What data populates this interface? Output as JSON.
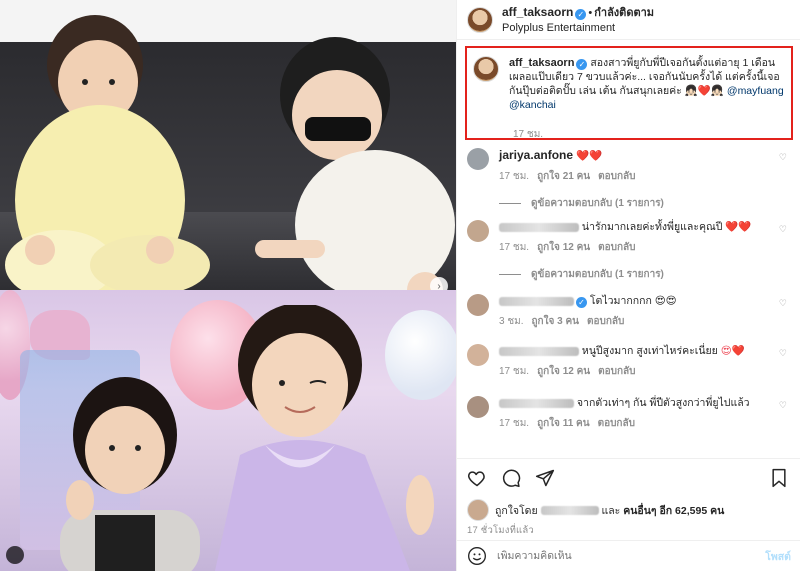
{
  "header": {
    "username": "aff_taksaorn",
    "follow_state": "กำลังติดตาม",
    "subtitle": "Polyplus Entertainment"
  },
  "caption": {
    "username": "aff_taksaorn",
    "text": "สองสาวพี่ยูกับพี่ปีเจอกันตั้งแต่อายุ 1 เดือน เผลอแป๊บเดียว 7 ขวบแล้วค่ะ... เจอกันนับครั้งได้ แต่ครั้งนี้เจอกันปุ๊บต่อติดปั๊บ เล่น เต้น กันสนุกเลยค่ะ",
    "emojis": "👧🏻❤️👧🏻",
    "mention1": "@mayfuang",
    "mention2": "@kanchai",
    "time": "17 ชม."
  },
  "comments": [
    {
      "username": "jariya.anfone",
      "text": "",
      "emoji": "❤️❤️",
      "time": "17 ชม.",
      "likes": "ถูกใจ 21 คน",
      "reply": "ตอบกลับ",
      "view_replies": "ดูข้อความตอบกลับ (1 รายการ)"
    },
    {
      "username": "",
      "text": "น่ารักมากเลยค่ะทั้งพี่ยูและคุณปี",
      "emoji": "❤️❤️",
      "time": "17 ชม.",
      "likes": "ถูกใจ 12 คน",
      "reply": "ตอบกลับ",
      "view_replies": "ดูข้อความตอบกลับ (1 รายการ)"
    },
    {
      "username": "",
      "text": "โตไวมากกกก",
      "emoji": "😍😍",
      "time": "3 ชม.",
      "likes": "ถูกใจ 3 คน",
      "reply": "ตอบกลับ",
      "view_replies": ""
    },
    {
      "username": "",
      "text": "หนูปีสูงมาก สูงเท่าไหร่คะเนี่ยย",
      "emoji": "😍❤️",
      "time": "17 ชม.",
      "likes": "ถูกใจ 12 คน",
      "reply": "ตอบกลับ",
      "view_replies": ""
    },
    {
      "username": "",
      "text": "จากตัวเท่าๆ กัน พี่ปีตัวสูงกว่าพี่ยูไปแล้ว",
      "emoji": "",
      "time": "17 ชม.",
      "likes": "ถูกใจ 11 คน",
      "reply": "ตอบกลับ",
      "view_replies": ""
    }
  ],
  "actions": {
    "likes_prefix": "ถูกใจโดย",
    "likes_middle": "และ",
    "likes_count": "คนอื่นๆ อีก 62,595 คน",
    "post_age": "17 ชั่วโมงที่แล้ว"
  },
  "add_comment": {
    "placeholder": "เพิ่มความคิดเห็น",
    "post_label": "โพสต์"
  },
  "colors": {
    "highlight_border": "#e3221c",
    "mention": "#00376b",
    "verified": "#3897f0",
    "muted": "#8e8e8e"
  },
  "icons": [
    "verified-icon",
    "heart-icon",
    "comment-icon",
    "share-icon",
    "bookmark-icon",
    "smiley-icon",
    "carousel-next-icon",
    "tag-icon"
  ]
}
